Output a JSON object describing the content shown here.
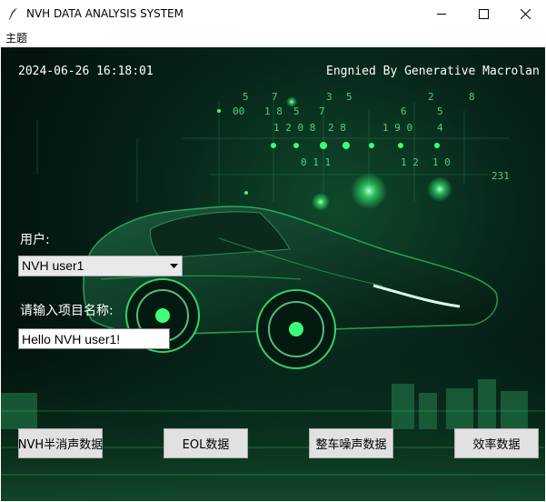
{
  "window": {
    "title": "NVH DATA ANALYSIS SYSTEM",
    "icon": "feather-icon"
  },
  "menu": {
    "items": [
      {
        "label": "主题"
      }
    ]
  },
  "header": {
    "datetime": "2024-06-26 16:18:01",
    "credit": "Engnied By Generative Macrolan"
  },
  "form": {
    "user_label": "用户:",
    "user_selected": "NVH user1",
    "project_label": "请输入项目名称:",
    "project_value": "Hello NVH user1!"
  },
  "buttons": [
    {
      "label": "NVH半消声数据"
    },
    {
      "label": "EOL数据"
    },
    {
      "label": "整车噪声数据"
    },
    {
      "label": "效率数据"
    }
  ],
  "colors": {
    "background": "#031510",
    "accent_green": "#3cff7a",
    "button_bg": "#e1e1e1"
  }
}
